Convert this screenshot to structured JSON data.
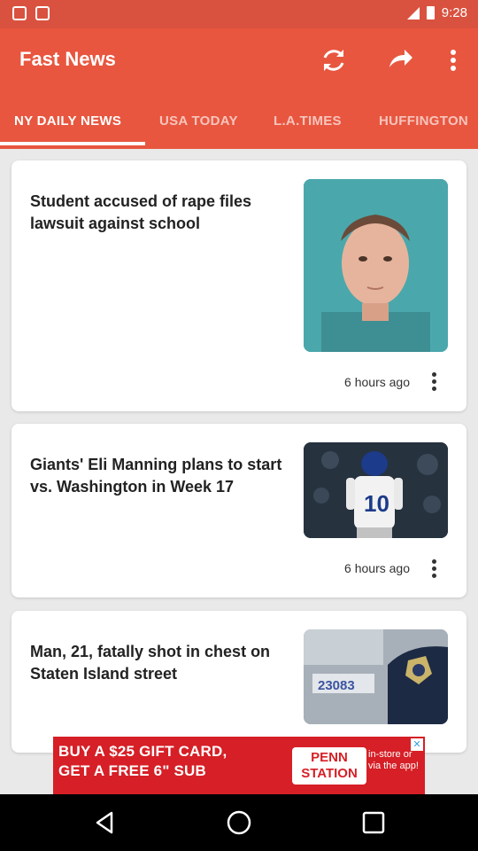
{
  "status": {
    "time": "9:28"
  },
  "app": {
    "title": "Fast News"
  },
  "tabs": [
    {
      "label": "NY DAILY NEWS",
      "active": true
    },
    {
      "label": "USA TODAY",
      "active": false
    },
    {
      "label": "L.A.TIMES",
      "active": false
    },
    {
      "label": "HUFFINGTON",
      "active": false
    }
  ],
  "articles": [
    {
      "title": "Student accused of rape files lawsuit against school",
      "time": "6 hours ago"
    },
    {
      "title": "Giants' Eli Manning plans to start vs. Washington in Week 17",
      "time": "6 hours ago"
    },
    {
      "title": "Man, 21, fatally shot in chest on Staten Island street"
    }
  ],
  "ad": {
    "line1": "BUY A $25 GIFT CARD,",
    "line2": "GET A FREE 6\" SUB",
    "brand_top": "PENN",
    "brand_bottom": "STATION",
    "side1": "in-store or",
    "side2": "via the app!"
  },
  "colors": {
    "primary": "#e8563f",
    "status_bar": "#d9523f",
    "ad_red": "#d61f26"
  }
}
